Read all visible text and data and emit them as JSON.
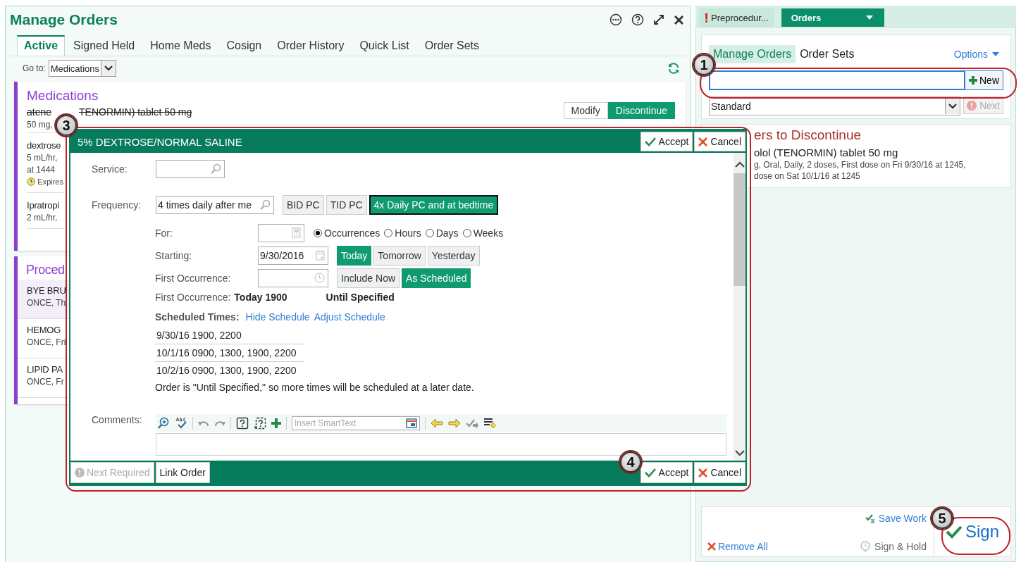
{
  "window": {
    "title": "Manage Orders"
  },
  "tabs": [
    {
      "label": "Active",
      "selected": true
    },
    {
      "label": "Signed Held",
      "selected": false
    },
    {
      "label": "Home Meds",
      "selected": false
    },
    {
      "label": "Cosign",
      "selected": false
    },
    {
      "label": "Order History",
      "selected": false
    },
    {
      "label": "Quick List",
      "selected": false
    },
    {
      "label": "Order Sets",
      "selected": false
    }
  ],
  "goto": {
    "label": "Go to:",
    "value": "Medications"
  },
  "medications": {
    "title": "Medications",
    "first_order": {
      "name_start": "atene",
      "name_end": "TENORMIN) tablet 50 mg",
      "discontinued": true,
      "detail": "50 mg,",
      "buttons": [
        {
          "label": "Modify",
          "selected": false
        },
        {
          "label": "Discontinue",
          "selected": true
        }
      ]
    },
    "orders": [
      {
        "lines": [
          "dextrose",
          "5 mL/hr,",
          "at 1444"
        ],
        "note": "Expires"
      },
      {
        "lines": [
          "Ipratropi",
          "2 mL/hr,"
        ]
      }
    ]
  },
  "procedures": {
    "title": "Proced",
    "orders": [
      {
        "name": "BYE BRU",
        "detail": "ONCE, Th",
        "selected": true
      },
      {
        "name": "HEMOG",
        "detail": "ONCE, Fri",
        "selected": false
      },
      {
        "name": "LIPID PA",
        "detail": "ONCE, Fr",
        "selected": false
      }
    ]
  },
  "dialog": {
    "badge": "3",
    "title": "5% DEXTROSE/NORMAL SALINE",
    "header_buttons": [
      "Accept",
      "Cancel"
    ],
    "service": {
      "label": "Service:"
    },
    "frequency": {
      "label": "Frequency:",
      "value": "4 times daily after me",
      "quick": [
        {
          "label": "BID PC",
          "selected": false
        },
        {
          "label": "TID PC",
          "selected": false
        },
        {
          "label": "4x Daily PC and at bedtime",
          "selected": true
        }
      ]
    },
    "for": {
      "label": "For:",
      "units": [
        {
          "label": "Occurrences",
          "selected": true
        },
        {
          "label": "Hours",
          "selected": false
        },
        {
          "label": "Days",
          "selected": false
        },
        {
          "label": "Weeks",
          "selected": false
        }
      ]
    },
    "starting": {
      "label": "Starting:",
      "value": "9/30/2016",
      "quick": [
        {
          "label": "Today",
          "selected": true
        },
        {
          "label": "Tomorrow",
          "selected": false
        },
        {
          "label": "Yesterday",
          "selected": false
        }
      ]
    },
    "first_occurrence": {
      "label": "First Occurrence:",
      "quick": [
        {
          "label": "Include Now",
          "selected": false
        },
        {
          "label": "As Scheduled",
          "selected": true
        }
      ]
    },
    "summary": {
      "label": "First Occurrence:",
      "value": "Today 1900",
      "end": "Until Specified"
    },
    "schedule": {
      "label": "Scheduled Times:",
      "links": [
        "Hide Schedule",
        "Adjust Schedule"
      ],
      "rows": [
        "9/30/16 1900, 2200",
        "10/1/16 0900, 1300, 1900, 2200",
        "10/2/16 0900, 1300, 1900, 2200"
      ],
      "note": "Order is \"Until Specified,\" so more times will be scheduled at a later date."
    },
    "comments": {
      "label": "Comments:",
      "smarttext_placeholder": "Insert SmartText"
    },
    "footer": {
      "next_required": {
        "label": "Next Required",
        "disabled": true
      },
      "link_order": "Link Order",
      "badge": "4",
      "buttons": [
        "Accept",
        "Cancel"
      ]
    }
  },
  "sidebar": {
    "tabs": [
      {
        "label": "Preprocedur...",
        "alert": true,
        "selected": false
      },
      {
        "label": "Orders",
        "alert": false,
        "selected": true
      }
    ],
    "subtabs": [
      {
        "label": "Manage Orders",
        "selected": true
      },
      {
        "label": "Order Sets",
        "selected": false
      }
    ],
    "options": "Options",
    "search": {
      "badge": "1",
      "button": "New"
    },
    "order_type": {
      "value": "Standard",
      "next": {
        "label": "Next",
        "disabled": true
      }
    },
    "discontinue": {
      "title": "ers to Discontinue",
      "name": "olol (TENORMIN) tablet 50 mg",
      "details": [
        "g, Oral, Daily, 2 doses, First dose on Fri 9/30/16 at 1245,",
        "dose on Sat 10/1/16 at 1245"
      ]
    },
    "actions": {
      "save_work": "Save Work",
      "remove_all": "Remove All",
      "sign_hold": {
        "label": "Sign & Hold",
        "disabled": true
      },
      "sign": "Sign",
      "badge": "5"
    }
  }
}
